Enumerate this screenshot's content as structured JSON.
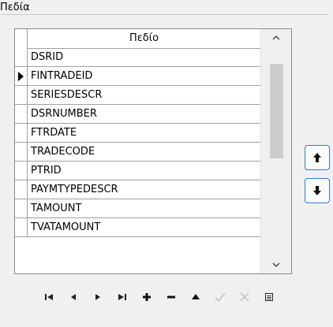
{
  "group": {
    "label": "Πεδία"
  },
  "grid": {
    "column_header": "Πεδίο",
    "current_row": 1,
    "rows": [
      "DSRID",
      "FINTRADEID",
      "SERIESDESCR",
      "DSRNUMBER",
      "FTRDATE",
      "TRADECODE",
      "PTRID",
      "PAYMTYPEDESCR",
      "TAMOUNT",
      "TVATAMOUNT"
    ]
  },
  "side_buttons": {
    "up_icon": "arrow-up-icon",
    "down_icon": "arrow-down-icon"
  },
  "navigator": {
    "icons": [
      "first-record-icon",
      "prior-record-icon",
      "next-record-icon",
      "last-record-icon",
      "insert-icon",
      "delete-icon",
      "edit-icon",
      "post-icon",
      "cancel-icon",
      "refresh-icon"
    ]
  }
}
